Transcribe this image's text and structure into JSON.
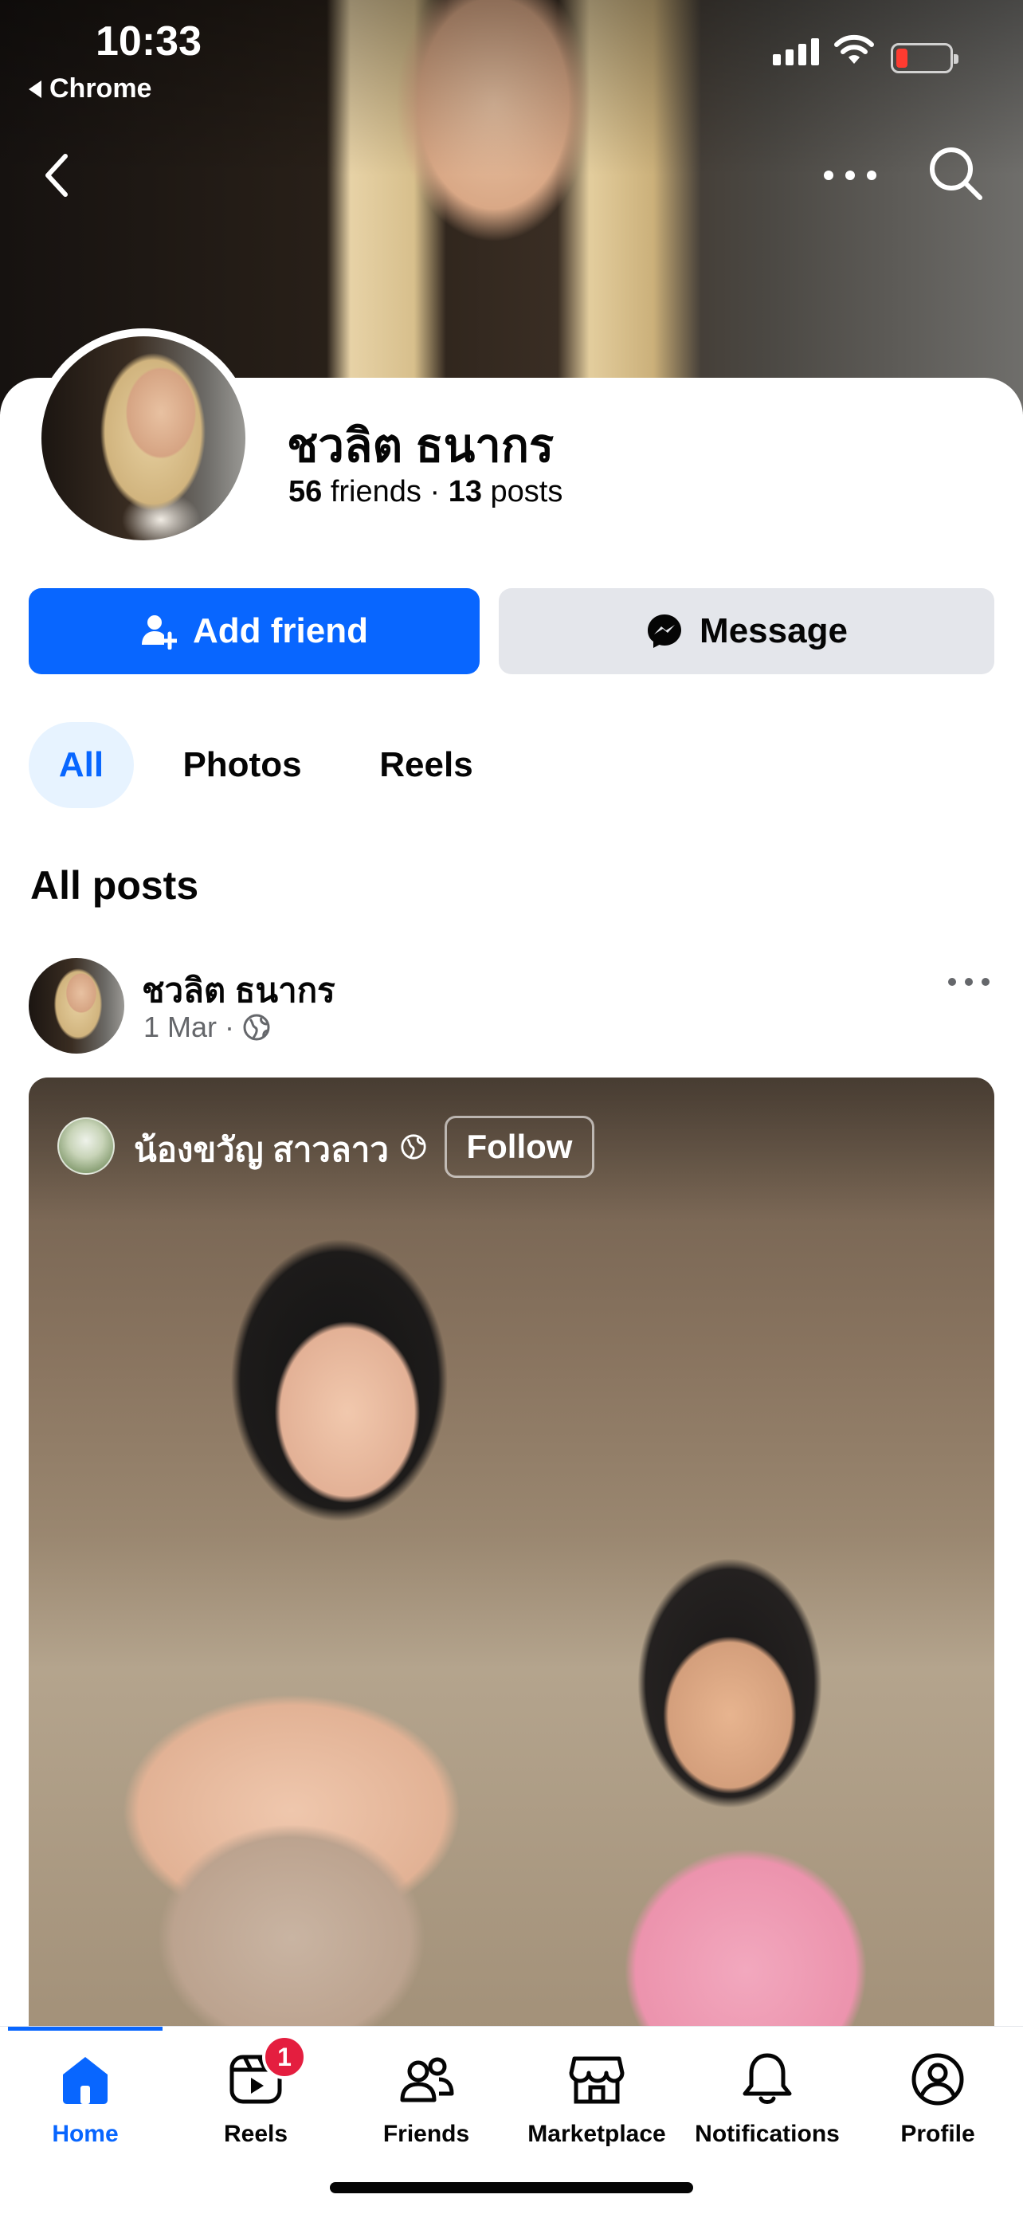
{
  "status_bar": {
    "time": "10:33",
    "back_app": "Chrome"
  },
  "header": {
    "back_icon": "chevron-left-icon",
    "more_icon": "more-horizontal-icon",
    "search_icon": "search-icon"
  },
  "profile": {
    "name": "ชวลิต ธนากร",
    "friends_count": "56",
    "friends_label": "friends",
    "separator": "·",
    "posts_count": "13",
    "posts_label": "posts"
  },
  "actions": {
    "add_friend_label": "Add friend",
    "message_label": "Message"
  },
  "tabs": [
    {
      "label": "All",
      "active": true
    },
    {
      "label": "Photos",
      "active": false
    },
    {
      "label": "Reels",
      "active": false
    }
  ],
  "section_title": "All posts",
  "post": {
    "author": "ชวลิต ธนากร",
    "date": "1 Mar",
    "separator": "·",
    "privacy_icon": "globe-icon",
    "reel": {
      "author": "น้องขวัญ สาวลาว",
      "follow_label": "Follow"
    }
  },
  "bottom_nav": [
    {
      "label": "Home",
      "icon": "home-icon",
      "active": true
    },
    {
      "label": "Reels",
      "icon": "reels-icon",
      "active": false,
      "badge": "1"
    },
    {
      "label": "Friends",
      "icon": "friends-icon",
      "active": false
    },
    {
      "label": "Marketplace",
      "icon": "marketplace-icon",
      "active": false
    },
    {
      "label": "Notifications",
      "icon": "bell-icon",
      "active": false
    },
    {
      "label": "Profile",
      "icon": "profile-icon",
      "active": false
    }
  ],
  "colors": {
    "accent": "#0866ff",
    "button_secondary": "#e4e6eb",
    "badge": "#e41e3f",
    "muted_text": "#65676b"
  }
}
